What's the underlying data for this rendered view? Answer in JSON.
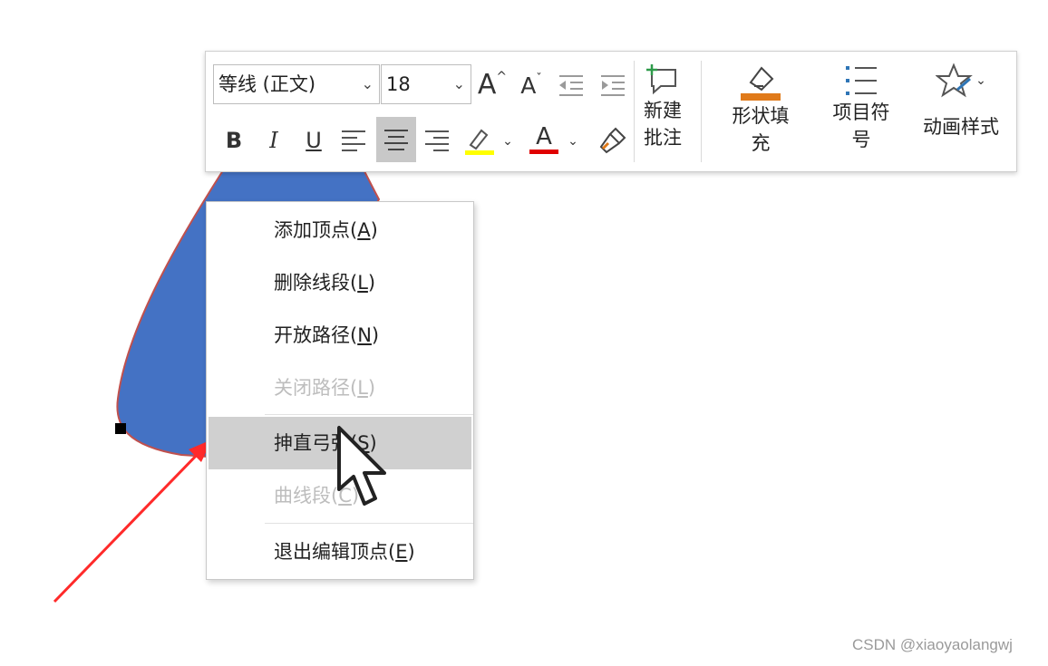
{
  "toolbar": {
    "font_name": "等线 (正文)",
    "font_size": "18",
    "grow_font": "A",
    "shrink_font": "A",
    "bold": "B",
    "italic": "I",
    "underline": "U",
    "font_color_letter": "A",
    "highlight_color": "#ffff00",
    "font_color": "#e00000",
    "new_comment": [
      "新建",
      "批注"
    ],
    "shape_fill": [
      "形状填",
      "充"
    ],
    "shape_fill_color": "#e07a1a",
    "bullets": [
      "项目符",
      "号"
    ],
    "animation_styles": "动画样式",
    "accent_color": "#2e75b6"
  },
  "context_menu": {
    "items": [
      {
        "label": "添加顶点(",
        "key": "A",
        "tail": ")",
        "state": "enabled"
      },
      {
        "label": "删除线段(",
        "key": "L",
        "tail": ")",
        "state": "enabled"
      },
      {
        "label": "开放路径(",
        "key": "N",
        "tail": ")",
        "state": "enabled"
      },
      {
        "label": "关闭路径(",
        "key": "L",
        "tail": ")",
        "state": "disabled"
      },
      {
        "label": "抻直弓弦(",
        "key": "S",
        "tail": ")",
        "state": "highlighted"
      },
      {
        "label": "曲线段(",
        "key": "C",
        "tail": ")",
        "state": "disabled"
      },
      {
        "label": "退出编辑顶点(",
        "key": "E",
        "tail": ")",
        "state": "enabled"
      }
    ]
  },
  "shape": {
    "fill": "#4472c4",
    "outline": "#c0504d"
  },
  "annotation_arrow_color": "#ff2a2a",
  "watermark": "CSDN @xiaoyaolangwj"
}
